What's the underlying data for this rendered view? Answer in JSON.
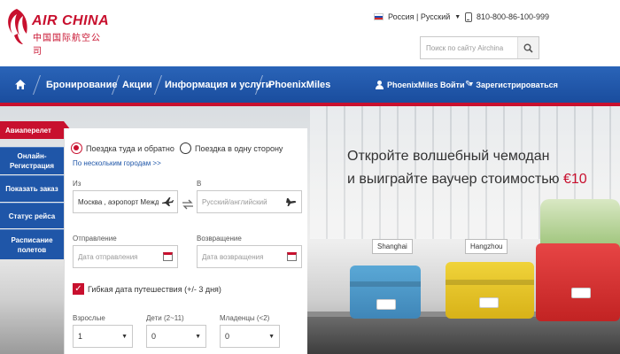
{
  "header": {
    "logo": {
      "name_en": "AIR CHINA",
      "name_cn": "中国国际航空公司"
    },
    "language": {
      "label": "Россия | Русский"
    },
    "phone": "810-800-86-100-999",
    "search": {
      "placeholder": "Поиск по сайту Airchina"
    }
  },
  "nav": {
    "items": [
      {
        "label": "Бронирование"
      },
      {
        "label": "Акции"
      },
      {
        "label": "Информация и услуги"
      },
      {
        "label": "PhoenixMiles"
      }
    ],
    "login_label": "PhoenixMiles Войти",
    "register_label": "Зарегистрироваться"
  },
  "sidebar": {
    "items": [
      {
        "label": "Авиаперелет",
        "active": true
      },
      {
        "label": "Онлайн-Регистрация"
      },
      {
        "label": "Показать заказ"
      },
      {
        "label": "Статус рейса"
      },
      {
        "label": "Расписание полетов"
      }
    ]
  },
  "booking": {
    "trip_round": "Поездка туда и обратно",
    "trip_oneway": "Поездка в одну сторону",
    "multi_city": "По нескольким городам >>",
    "from_label": "Из",
    "from_value": "Москва , аэропорт Междуна",
    "to_label": "В",
    "to_placeholder": "Русский/английский",
    "depart_label": "Отправление",
    "depart_placeholder": "Дата отправления",
    "return_label": "Возвращение",
    "return_placeholder": "Дата возвращения",
    "flexible_label": "Гибкая дата путешествия (+/- 3 дня)",
    "adults_label": "Взрослые",
    "adults_value": "1",
    "children_label": "Дети (2~11)",
    "children_value": "0",
    "infants_label": "Младенцы (<2)",
    "infants_value": "0"
  },
  "banner": {
    "line1": "Откройте волшебный чемодан",
    "line2": "и выиграйте ваучер стоимостью ",
    "line2_highlight": "€10",
    "tags": [
      "Shanghai",
      "Hangzhou"
    ]
  },
  "colors": {
    "brand_red": "#c8102e",
    "nav_blue": "#1f56a8"
  }
}
